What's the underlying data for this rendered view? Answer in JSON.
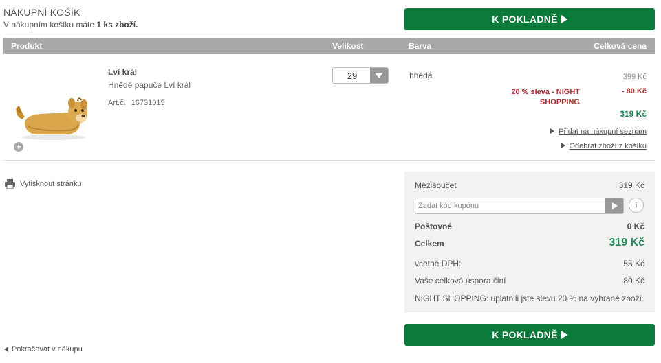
{
  "header": {
    "title": "NÁKUPNÍ KOŠÍK",
    "cart_text_prefix": "V nákupním košíku máte ",
    "cart_count": "1 ks zboží.",
    "checkout_label": "K POKLADNĚ"
  },
  "table": {
    "columns": {
      "product": "Produkt",
      "size": "Velikost",
      "color": "Barva",
      "total_price": "Celková cena"
    }
  },
  "item": {
    "name": "Lví král",
    "description": "Hnědé papuče Lví král",
    "art_label": "Art.č.",
    "art_number": "16731015",
    "size": "29",
    "color": "hnědá",
    "price_original": "399 Kč",
    "discount_label": "20 % sleva - NIGHT SHOPPING",
    "discount_value": "- 80 Kč",
    "price_final": "319 Kč",
    "add_wishlist": "Přidat na nákupní seznam",
    "remove": "Odebrat zboží z košíku"
  },
  "print_label": "Vytisknout stránku",
  "summary": {
    "subtotal_label": "Mezisoučet",
    "subtotal_value": "319 Kč",
    "coupon_placeholder": "Zadat kód kupónu",
    "shipping_label": "Poštovné",
    "shipping_value": "0 Kč",
    "total_label": "Celkem",
    "total_value": "319 Kč",
    "vat_label": "včetně DPH:",
    "vat_value": "55 Kč",
    "savings_label": "Vaše celková úspora činí",
    "savings_value": "80 Kč",
    "night_note": "NIGHT SHOPPING: uplatnili jste slevu 20 % na vybrané zboží."
  },
  "continue_label": "Pokračovat v nákupu",
  "colors": {
    "checkout_green": "#0b7a3a",
    "price_green": "#1f8a55",
    "discount_red": "#b0282d",
    "header_gray": "#a9a9a9"
  }
}
